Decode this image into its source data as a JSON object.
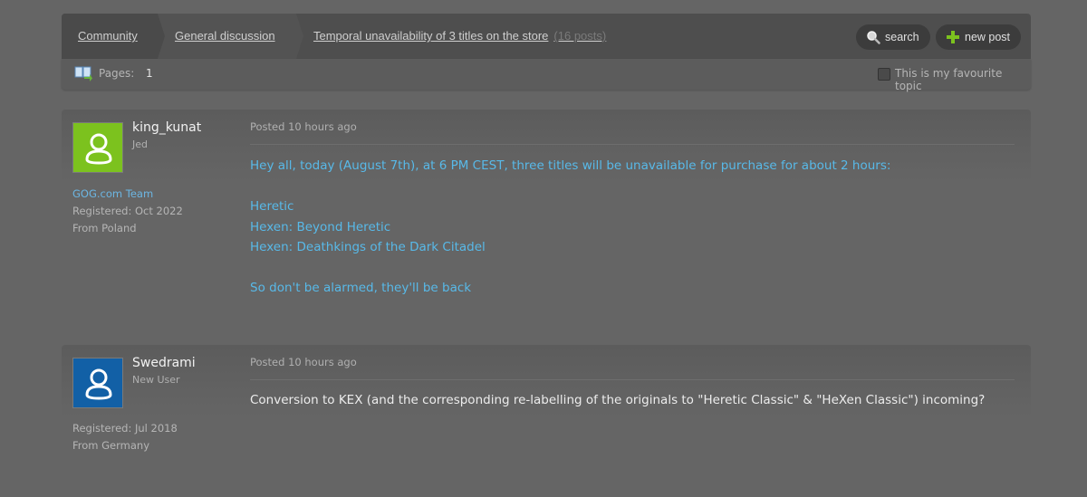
{
  "breadcrumb": {
    "community": "Community",
    "general": "General discussion",
    "topic": "Temporal unavailability of 3 titles on the store",
    "post_count": "(16 posts)"
  },
  "actions": {
    "search": "search",
    "new_post": "new post"
  },
  "pagination": {
    "label": "Pages:",
    "current": "1"
  },
  "favourite": {
    "label": "This is my favourite topic",
    "checked": false
  },
  "posts": [
    {
      "username": "king_kunat",
      "rank": "Jed",
      "team": "GOG.com Team",
      "registered": "Registered: Oct 2022",
      "from": "From Poland",
      "posted": "Posted 10 hours ago",
      "avatar_color": "#7cc21e",
      "lines": [
        "Hey all, today (August 7th), at 6 PM CEST, three titles will be unavailable for purchase for about 2 hours:",
        "Heretic",
        "Hexen: Beyond Heretic",
        "Hexen: Deathkings of the Dark Citadel",
        "So don't be alarmed, they'll be back"
      ]
    },
    {
      "username": "Swedrami",
      "rank": "New User",
      "registered": "Registered: Jul 2018",
      "from": "From Germany",
      "posted": "Posted 10 hours ago",
      "avatar_color": "#1260a6",
      "lines": [
        "Conversion to KEX (and the corresponding re-labelling of the originals to \"Heretic Classic\" & \"HeXen Classic\") incoming?"
      ]
    }
  ],
  "colors": {
    "link_blue": "#58b9e8",
    "background": "#656565"
  }
}
